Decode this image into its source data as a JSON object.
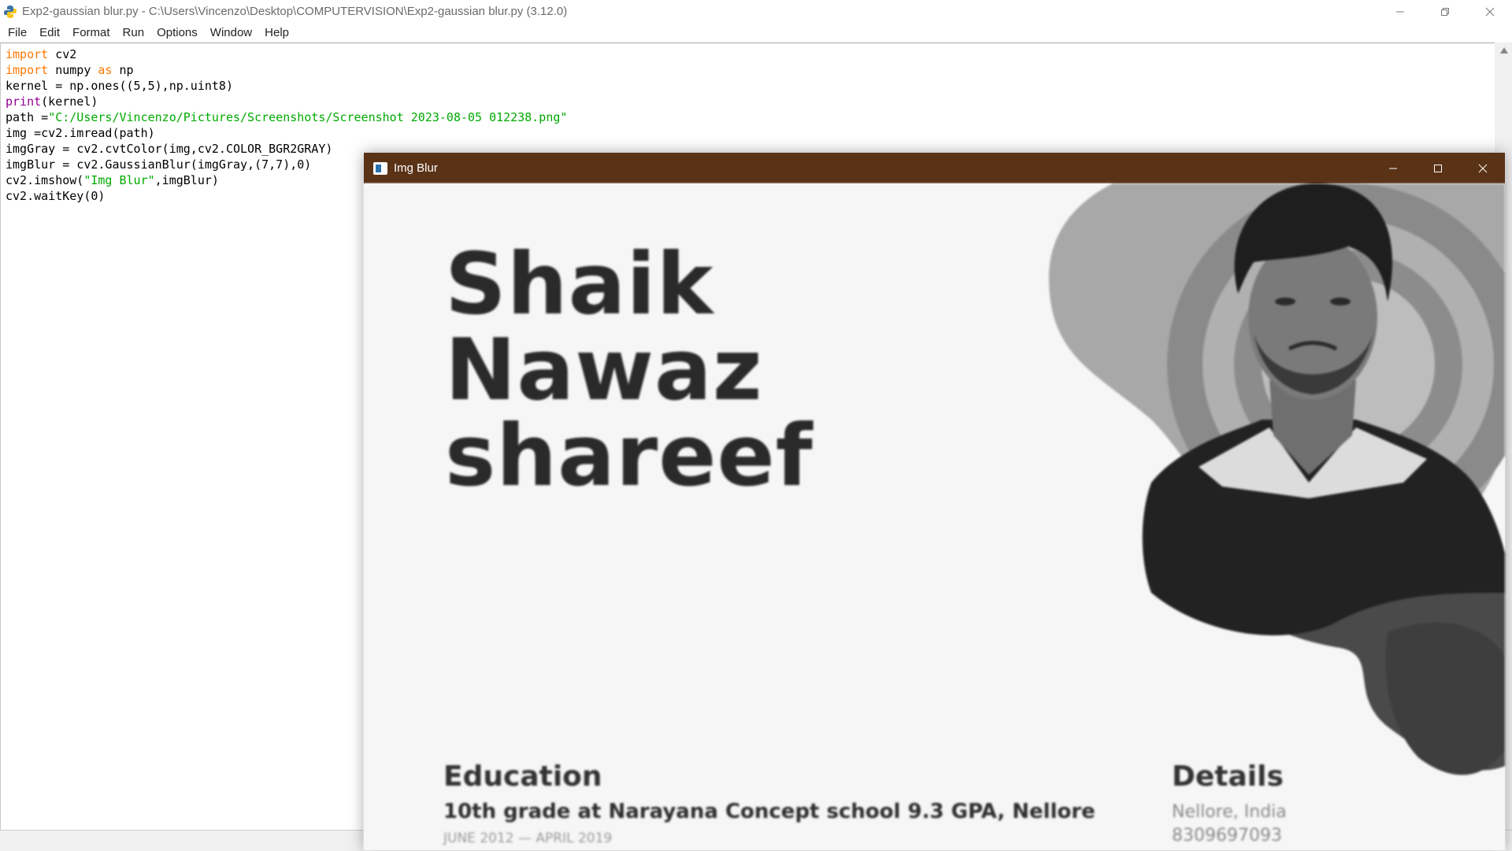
{
  "idle": {
    "title": "Exp2-gaussian blur.py - C:\\Users\\Vincenzo\\Desktop\\COMPUTERVISION\\Exp2-gaussian blur.py (3.12.0)",
    "menu": [
      "File",
      "Edit",
      "Format",
      "Run",
      "Options",
      "Window",
      "Help"
    ],
    "code": [
      [
        {
          "t": "import",
          "c": "kw"
        },
        {
          "t": " cv2",
          "c": ""
        }
      ],
      [
        {
          "t": "import",
          "c": "kw"
        },
        {
          "t": " numpy ",
          "c": ""
        },
        {
          "t": "as",
          "c": "kw"
        },
        {
          "t": " np",
          "c": ""
        }
      ],
      [
        {
          "t": "kernel = np.ones((5,5),np.uint8)",
          "c": ""
        }
      ],
      [
        {
          "t": "print",
          "c": "bi"
        },
        {
          "t": "(kernel)",
          "c": ""
        }
      ],
      [
        {
          "t": "path =",
          "c": ""
        },
        {
          "t": "\"C:/Users/Vincenzo/Pictures/Screenshots/Screenshot 2023-08-05 012238.png\"",
          "c": "str"
        }
      ],
      [
        {
          "t": "img =cv2.imread(path)",
          "c": ""
        }
      ],
      [
        {
          "t": "imgGray = cv2.cvtColor(img,cv2.COLOR_BGR2GRAY)",
          "c": ""
        }
      ],
      [
        {
          "t": "imgBlur = cv2.GaussianBlur(imgGray,(7,7),0)",
          "c": ""
        }
      ],
      [
        {
          "t": "cv2.imshow(",
          "c": ""
        },
        {
          "t": "\"Img Blur\"",
          "c": "str"
        },
        {
          "t": ",imgBlur)",
          "c": ""
        }
      ],
      [
        {
          "t": "cv2.waitKey(0)",
          "c": ""
        }
      ]
    ]
  },
  "cv_window": {
    "title": "Img Blur",
    "image": {
      "name_lines": [
        "Shaik",
        "Nawaz",
        "shareef"
      ],
      "education_heading": "Education",
      "education_item": "10th grade at Narayana Concept school 9.3 GPA, Nellore",
      "education_dates": "JUNE 2012 — APRIL 2019",
      "details_heading": "Details",
      "details_lines": [
        "Nellore, India",
        "8309697093"
      ]
    }
  }
}
